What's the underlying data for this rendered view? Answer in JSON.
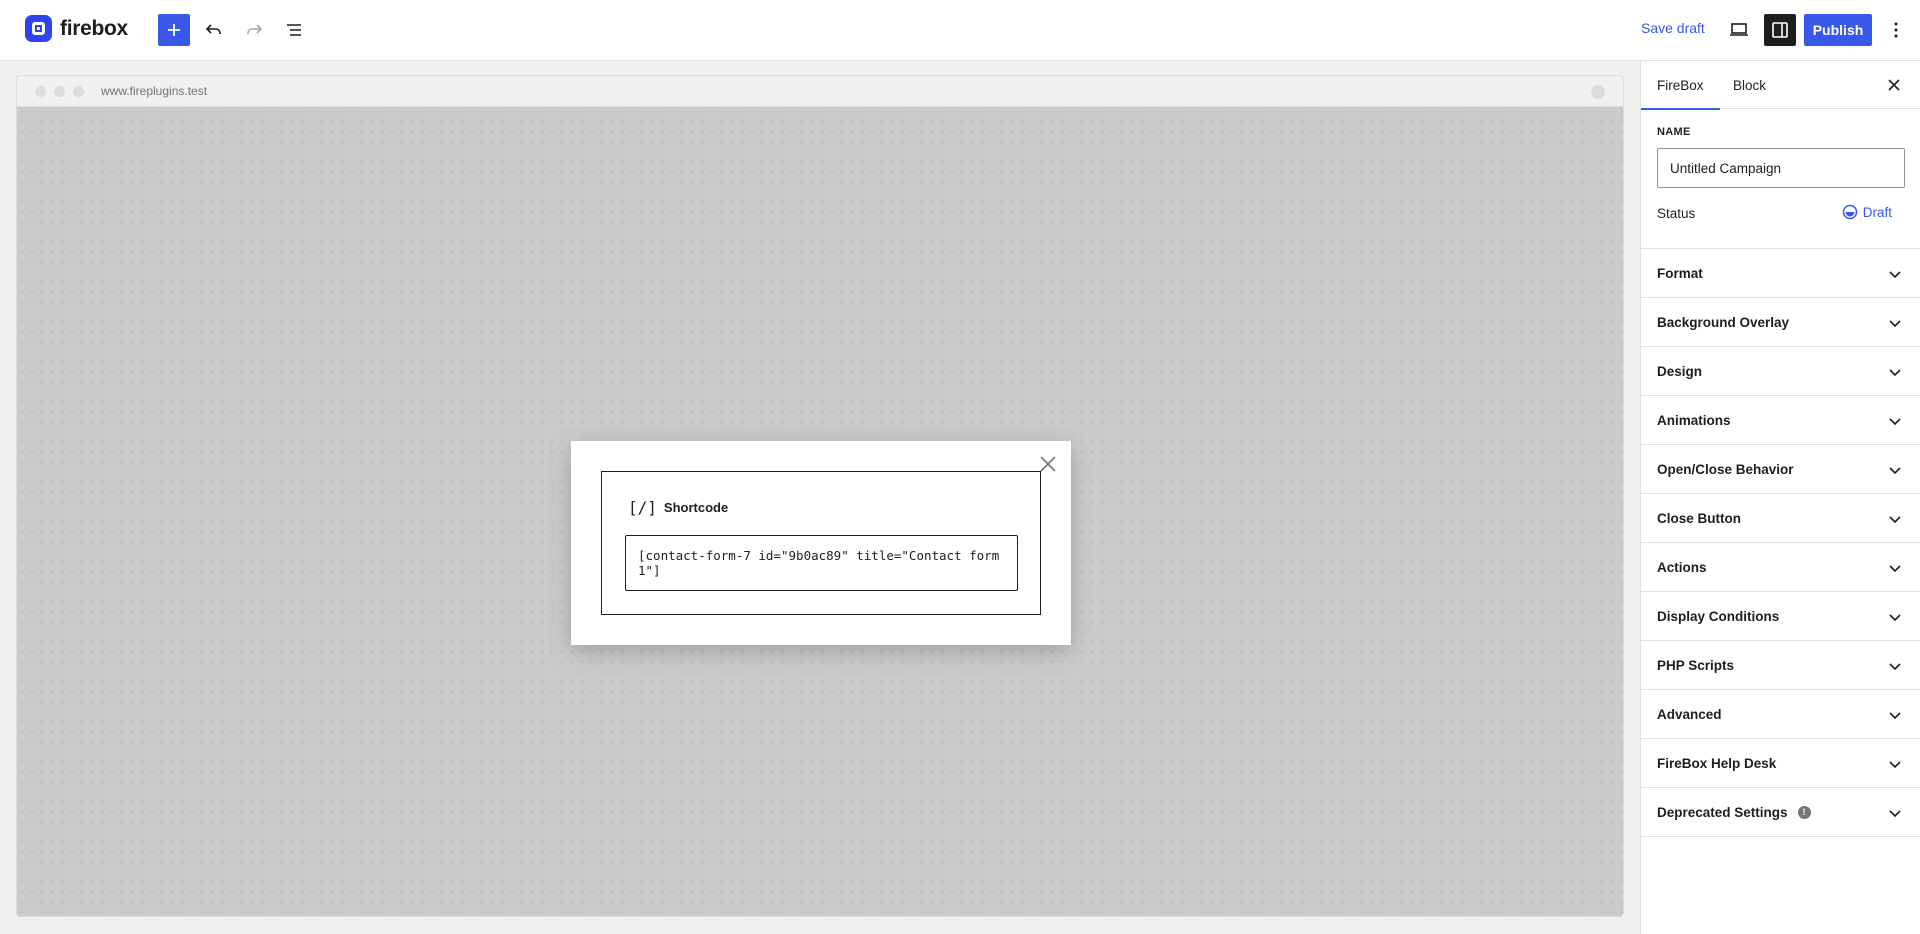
{
  "header": {
    "brand": "firebox",
    "save_draft_label": "Save draft",
    "publish_label": "Publish",
    "colors": {
      "accent": "#3858e9",
      "brand": "#2f43f0"
    }
  },
  "canvas": {
    "url": "www.fireplugins.test",
    "popup": {
      "block_title": "Shortcode",
      "block_icon": "[/]",
      "shortcode_value": "[contact-form-7 id=\"9b0ac89\" title=\"Contact form 1\"]"
    }
  },
  "sidebar": {
    "tabs": [
      {
        "label": "FireBox",
        "active": true
      },
      {
        "label": "Block",
        "active": false
      }
    ],
    "name_label": "NAME",
    "name_value": "Untitled Campaign",
    "status_label": "Status",
    "status_value": "Draft",
    "panels": [
      {
        "label": "Format"
      },
      {
        "label": "Background Overlay"
      },
      {
        "label": "Design"
      },
      {
        "label": "Animations"
      },
      {
        "label": "Open/Close Behavior"
      },
      {
        "label": "Close Button"
      },
      {
        "label": "Actions"
      },
      {
        "label": "Display Conditions"
      },
      {
        "label": "PHP Scripts"
      },
      {
        "label": "Advanced"
      },
      {
        "label": "FireBox Help Desk"
      },
      {
        "label": "Deprecated Settings",
        "info_icon": true
      }
    ]
  }
}
